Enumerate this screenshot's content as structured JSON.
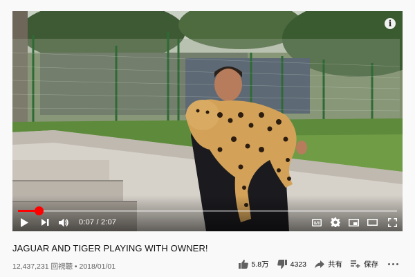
{
  "video": {
    "title": "JAGUAR AND TIGER PLAYING WITH OWNER!",
    "views": "12,437,231 回視聴",
    "separator": " • ",
    "date": "2018/01/01"
  },
  "player": {
    "current_time": "0:07",
    "time_separator": " / ",
    "duration": "2:07",
    "progress_fraction": 0.055,
    "accent_color": "#ff0000",
    "icons": [
      "play-icon",
      "next-icon",
      "volume-icon",
      "subtitles-icon",
      "settings-icon",
      "miniplayer-icon",
      "theater-icon",
      "fullscreen-icon",
      "info-icon"
    ],
    "info_label": "i"
  },
  "actions": {
    "like_count": "5.8万",
    "dislike_count": "4323",
    "share_label": "共有",
    "save_label": "保存"
  }
}
